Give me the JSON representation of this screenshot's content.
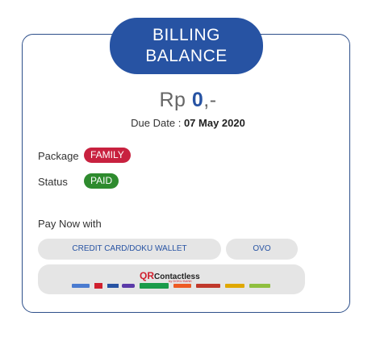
{
  "header": {
    "title_line1": "BILLING",
    "title_line2": "BALANCE"
  },
  "balance": {
    "currency": "Rp",
    "amount": "0",
    "suffix": ",-"
  },
  "due": {
    "label": "Due Date :",
    "date": "07 May 2020"
  },
  "package": {
    "label": "Package",
    "value": "FAMILY"
  },
  "status": {
    "label": "Status",
    "value": "PAID"
  },
  "pay": {
    "label": "Pay Now with",
    "credit_card_label": "CREDIT CARD/DOKU WALLET",
    "ovo_label": "OVO",
    "qr_prefix": "QR",
    "qr_label": "Contactless",
    "qr_sub": "by DOKU BANK",
    "qr_logos": [
      "bank-logo",
      "bca-logo",
      "ovo-logo",
      "gopay-logo",
      "shopee-logo",
      "cimb-logo",
      "maybank-logo",
      "permata-logo"
    ]
  },
  "colors": {
    "brand_blue": "#2753a3",
    "family_badge": "#c8213f",
    "paid_badge": "#2e8b2e"
  }
}
